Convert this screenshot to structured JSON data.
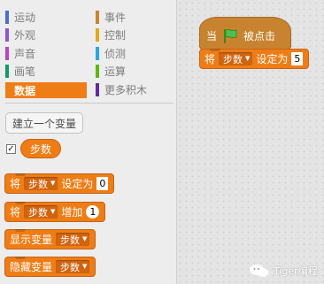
{
  "categories": [
    {
      "label": "运动",
      "color": "#4a6cd4"
    },
    {
      "label": "外观",
      "color": "#8a55d7"
    },
    {
      "label": "声音",
      "color": "#bb42c3"
    },
    {
      "label": "画笔",
      "color": "#0e9a6c"
    },
    {
      "label": "数据",
      "color": "#ee7d16",
      "active": true
    },
    {
      "label": "事件",
      "color": "#c88330"
    },
    {
      "label": "控制",
      "color": "#e1a91a"
    },
    {
      "label": "侦测",
      "color": "#2ca5e2"
    },
    {
      "label": "运算",
      "color": "#5cb712"
    },
    {
      "label": "更多积木",
      "color": "#632d99"
    }
  ],
  "palette": {
    "make_variable_label": "建立一个变量",
    "variable_checked": true,
    "variable_name": "步数",
    "blocks": {
      "set": {
        "prefix": "将",
        "var": "步数",
        "middle": "设定为",
        "value": "0"
      },
      "change": {
        "prefix": "将",
        "var": "步数",
        "middle": "增加",
        "value": "1"
      },
      "show": {
        "label": "显示变量",
        "var": "步数"
      },
      "hide": {
        "label": "隐藏变量",
        "var": "步数"
      }
    }
  },
  "script": {
    "hat": {
      "prefix": "当",
      "suffix": "被点击",
      "icon": "green-flag-icon"
    },
    "set": {
      "prefix": "将",
      "var": "步数",
      "middle": "设定为",
      "value": "5"
    }
  },
  "watermark": {
    "text": "Tiger编程"
  }
}
